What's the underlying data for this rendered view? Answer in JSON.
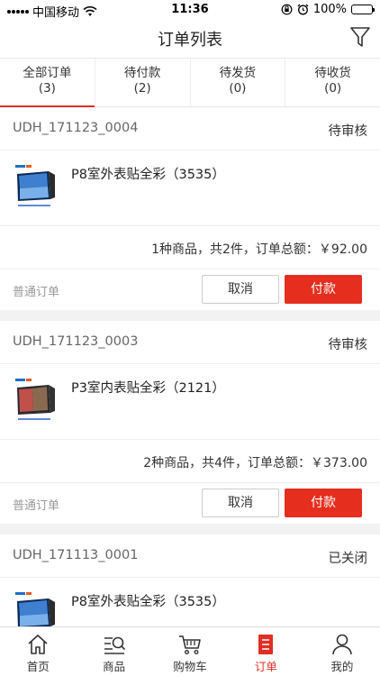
{
  "status_bar": {
    "carrier": "中国移动",
    "time": "11:36",
    "battery": "100%"
  },
  "nav": {
    "title": "订单列表"
  },
  "tabs": [
    {
      "label": "全部订单",
      "count": "(3)"
    },
    {
      "label": "待付款",
      "count": "(2)"
    },
    {
      "label": "待发货",
      "count": "(0)"
    },
    {
      "label": "待收货",
      "count": "(0)"
    }
  ],
  "orders": [
    {
      "no": "UDH_171123_0004",
      "status": "待审核",
      "item_name": "P8室外表贴全彩（3535）",
      "summary": "1种商品，共2件，订单总额：￥92.00",
      "type": "普通订单",
      "cancel_label": "取消",
      "pay_label": "付款"
    },
    {
      "no": "UDH_171123_0003",
      "status": "待审核",
      "item_name": "P3室内表贴全彩（2121）",
      "summary": "2种商品，共4件，订单总额：￥373.00",
      "type": "普通订单",
      "cancel_label": "取消",
      "pay_label": "付款"
    },
    {
      "no": "UDH_171113_0001",
      "status": "已关闭",
      "item_name": "P8室外表贴全彩（3535）"
    }
  ],
  "tabbar": [
    {
      "label": "首页",
      "icon": "home-icon"
    },
    {
      "label": "商品",
      "icon": "search-list-icon"
    },
    {
      "label": "购物车",
      "icon": "cart-icon"
    },
    {
      "label": "订单",
      "icon": "order-icon"
    },
    {
      "label": "我的",
      "icon": "user-icon"
    }
  ],
  "colors": {
    "accent": "#e02e24",
    "pay_button": "#e62e1e"
  }
}
